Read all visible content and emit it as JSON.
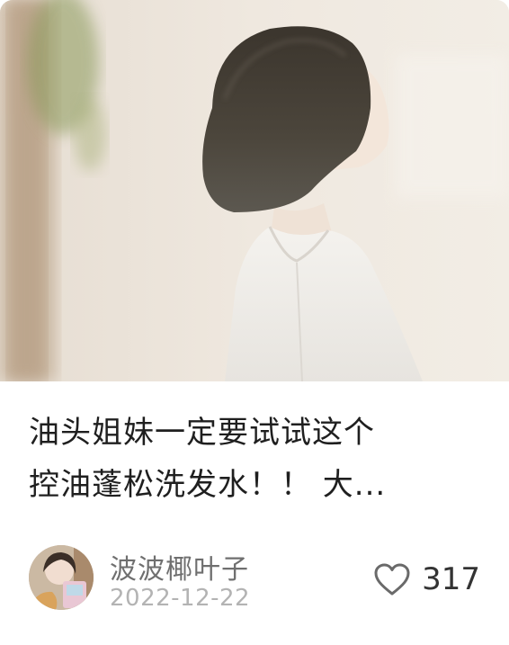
{
  "post": {
    "title_line1": "油头姐妹一定要试试这个",
    "title_line2": "控油蓬松洗发水！！ 大...",
    "author_name": "波波椰叶子",
    "date": "2022-12-22",
    "like_count": "317"
  },
  "icons": {
    "like": "heart-outline-icon"
  },
  "colors": {
    "title_text": "#1f1f1f",
    "author_text": "#6f6f6f",
    "date_text": "#b3b3b3",
    "heart_stroke": "#6a6a6a"
  }
}
